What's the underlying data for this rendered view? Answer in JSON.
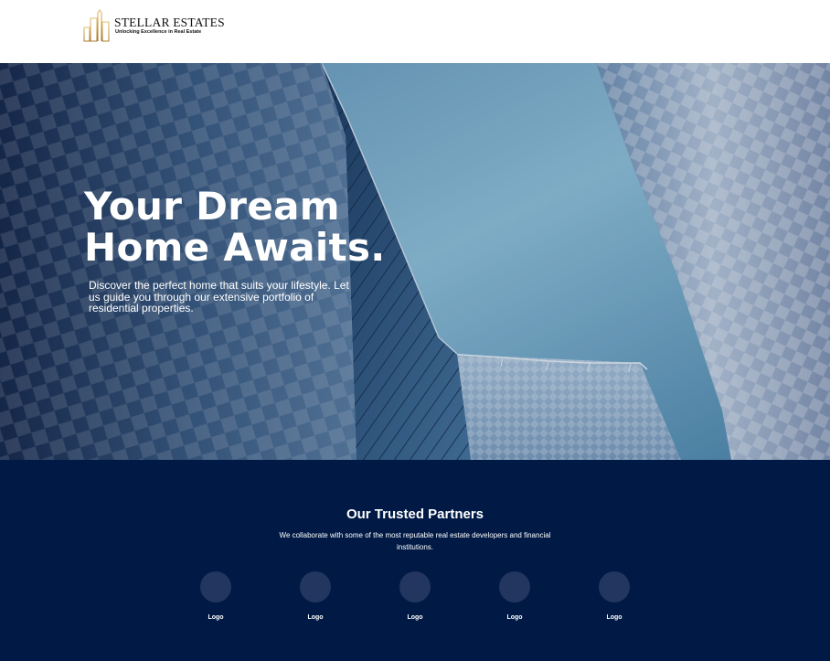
{
  "brand": {
    "name": "STELLAR ESTATES",
    "tagline": "Unlocking Excellence in Real Estate",
    "accent_color": "#c9a04a"
  },
  "hero": {
    "title": "Your Dream\nHome Awaits.",
    "description": "Discover the perfect home that suits your lifestyle. Let us guide you through our extensive portfolio of residential properties."
  },
  "partners": {
    "title": "Our Trusted Partners",
    "description": "We collaborate with some of the most reputable real estate developers and financial institutions.",
    "logos": [
      {
        "label": "Logo"
      },
      {
        "label": "Logo"
      },
      {
        "label": "Logo"
      },
      {
        "label": "Logo"
      },
      {
        "label": "Logo"
      }
    ],
    "background_color": "#001a45"
  }
}
